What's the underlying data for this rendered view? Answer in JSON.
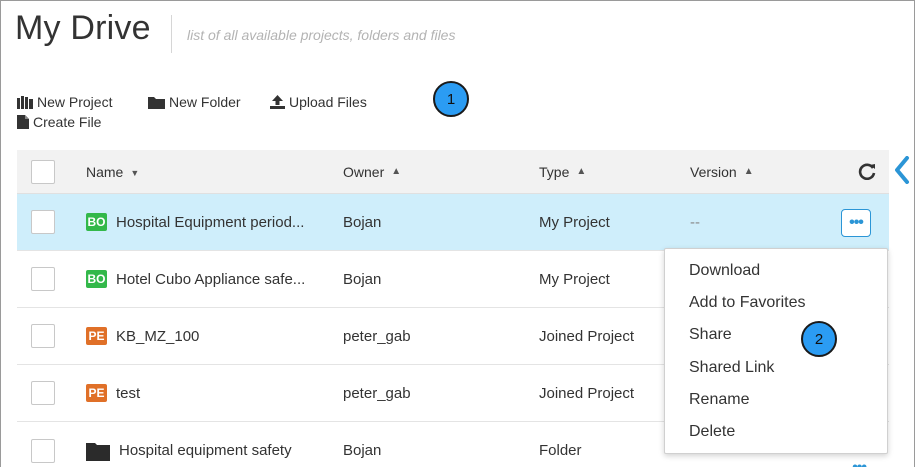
{
  "header": {
    "title": "My Drive",
    "subtitle": "list of all available projects, folders and files"
  },
  "toolbar": {
    "new_project": "New Project",
    "new_folder": "New Folder",
    "upload_files": "Upload Files",
    "create_file": "Create File"
  },
  "callouts": {
    "one": "1",
    "two": "2"
  },
  "table": {
    "columns": {
      "name": "Name",
      "owner": "Owner",
      "type": "Type",
      "version": "Version"
    },
    "rows": [
      {
        "badge": "BO",
        "name": "Hospital Equipment period...",
        "owner": "Bojan",
        "type": "My Project",
        "version": "--",
        "selected": true
      },
      {
        "badge": "BO",
        "name": "Hotel Cubo Appliance safe...",
        "owner": "Bojan",
        "type": "My Project",
        "version": ""
      },
      {
        "badge": "PE",
        "name": "KB_MZ_100",
        "owner": "peter_gab",
        "type": "Joined Project",
        "version": ""
      },
      {
        "badge": "PE",
        "name": "test",
        "owner": "peter_gab",
        "type": "Joined Project",
        "version": ""
      },
      {
        "badge": "",
        "icon": "folder-icon",
        "name": "Hospital equipment safety",
        "owner": "Bojan",
        "type": "Folder",
        "version": ""
      }
    ]
  },
  "context_menu": {
    "items": [
      "Download",
      "Add to Favorites",
      "Share",
      "Shared Link",
      "Rename",
      "Delete"
    ]
  },
  "colors": {
    "accent": "#2b95d6",
    "selected_row": "#cfeefb",
    "badge_bo": "#33b84a",
    "badge_pe": "#e07028",
    "callout": "#2b9cf3"
  }
}
